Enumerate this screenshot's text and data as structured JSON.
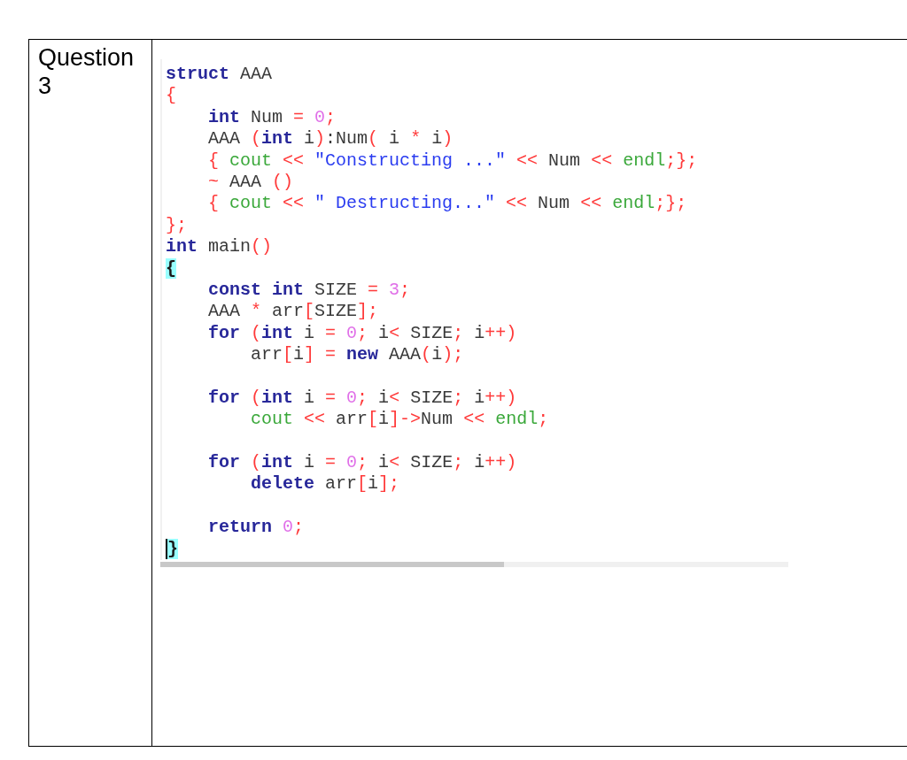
{
  "question": {
    "label": "Question 3"
  },
  "code": {
    "lines": [
      {
        "kind": "code",
        "t": [
          {
            "kind": "kw",
            "text": "struct"
          },
          {
            "kind": "id",
            "text": " AAA"
          }
        ]
      },
      {
        "kind": "code",
        "t": [
          {
            "kind": "op",
            "text": "{"
          }
        ]
      },
      {
        "kind": "code",
        "t": [
          {
            "kind": "kw",
            "text": "    int"
          },
          {
            "kind": "id",
            "text": " Num "
          },
          {
            "kind": "op",
            "text": "="
          },
          {
            "kind": "num",
            "text": " 0"
          },
          {
            "kind": "op",
            "text": ";"
          }
        ]
      },
      {
        "kind": "code",
        "t": [
          {
            "kind": "id",
            "text": "    AAA "
          },
          {
            "kind": "op",
            "text": "("
          },
          {
            "kind": "kw",
            "text": "int"
          },
          {
            "kind": "id",
            "text": " i"
          },
          {
            "kind": "op",
            "text": ")"
          },
          {
            "kind": "id",
            "text": ":Num"
          },
          {
            "kind": "op",
            "text": "("
          },
          {
            "kind": "id",
            "text": " i "
          },
          {
            "kind": "op",
            "text": "*"
          },
          {
            "kind": "id",
            "text": " i"
          },
          {
            "kind": "op",
            "text": ")"
          }
        ]
      },
      {
        "kind": "code",
        "t": [
          {
            "kind": "op",
            "text": "    {"
          },
          {
            "kind": "lib",
            "text": " cout"
          },
          {
            "kind": "op",
            "text": " <<"
          },
          {
            "kind": "str",
            "text": " \"Constructing ...\""
          },
          {
            "kind": "op",
            "text": " <<"
          },
          {
            "kind": "id",
            "text": " Num "
          },
          {
            "kind": "op",
            "text": "<<"
          },
          {
            "kind": "lib",
            "text": " endl"
          },
          {
            "kind": "op",
            "text": ";};"
          }
        ]
      },
      {
        "kind": "code",
        "t": [
          {
            "kind": "op",
            "text": "    ~"
          },
          {
            "kind": "id",
            "text": " AAA "
          },
          {
            "kind": "op",
            "text": "()"
          }
        ]
      },
      {
        "kind": "code",
        "t": [
          {
            "kind": "op",
            "text": "    {"
          },
          {
            "kind": "lib",
            "text": " cout"
          },
          {
            "kind": "op",
            "text": " <<"
          },
          {
            "kind": "str",
            "text": " \" Destructing...\""
          },
          {
            "kind": "op",
            "text": " <<"
          },
          {
            "kind": "id",
            "text": " Num "
          },
          {
            "kind": "op",
            "text": "<<"
          },
          {
            "kind": "lib",
            "text": " endl"
          },
          {
            "kind": "op",
            "text": ";};"
          }
        ]
      },
      {
        "kind": "code",
        "t": [
          {
            "kind": "op",
            "text": "};"
          }
        ]
      },
      {
        "kind": "code",
        "t": [
          {
            "kind": "kw",
            "text": "int"
          },
          {
            "kind": "id",
            "text": " main"
          },
          {
            "kind": "op",
            "text": "()"
          }
        ]
      },
      {
        "kind": "code",
        "t": [
          {
            "kind": "match",
            "text": "{"
          }
        ]
      },
      {
        "kind": "code",
        "t": [
          {
            "kind": "kw",
            "text": "    const int"
          },
          {
            "kind": "id",
            "text": " SIZE "
          },
          {
            "kind": "op",
            "text": "="
          },
          {
            "kind": "num",
            "text": " 3"
          },
          {
            "kind": "op",
            "text": ";"
          }
        ]
      },
      {
        "kind": "code",
        "t": [
          {
            "kind": "id",
            "text": "    AAA "
          },
          {
            "kind": "op",
            "text": "*"
          },
          {
            "kind": "id",
            "text": " arr"
          },
          {
            "kind": "op",
            "text": "["
          },
          {
            "kind": "id",
            "text": "SIZE"
          },
          {
            "kind": "op",
            "text": "];"
          }
        ]
      },
      {
        "kind": "code",
        "t": [
          {
            "kind": "kw",
            "text": "    for"
          },
          {
            "kind": "op",
            "text": " ("
          },
          {
            "kind": "kw",
            "text": "int"
          },
          {
            "kind": "id",
            "text": " i "
          },
          {
            "kind": "op",
            "text": "="
          },
          {
            "kind": "num",
            "text": " 0"
          },
          {
            "kind": "op",
            "text": ";"
          },
          {
            "kind": "id",
            "text": " i"
          },
          {
            "kind": "op",
            "text": "<"
          },
          {
            "kind": "id",
            "text": " SIZE"
          },
          {
            "kind": "op",
            "text": ";"
          },
          {
            "kind": "id",
            "text": " i"
          },
          {
            "kind": "op",
            "text": "++)"
          }
        ]
      },
      {
        "kind": "code",
        "t": [
          {
            "kind": "id",
            "text": "        arr"
          },
          {
            "kind": "op",
            "text": "["
          },
          {
            "kind": "id",
            "text": "i"
          },
          {
            "kind": "op",
            "text": "] ="
          },
          {
            "kind": "kw",
            "text": " new"
          },
          {
            "kind": "id",
            "text": " AAA"
          },
          {
            "kind": "op",
            "text": "("
          },
          {
            "kind": "id",
            "text": "i"
          },
          {
            "kind": "op",
            "text": ");"
          }
        ]
      },
      {
        "kind": "blank"
      },
      {
        "kind": "code",
        "t": [
          {
            "kind": "kw",
            "text": "    for"
          },
          {
            "kind": "op",
            "text": " ("
          },
          {
            "kind": "kw",
            "text": "int"
          },
          {
            "kind": "id",
            "text": " i "
          },
          {
            "kind": "op",
            "text": "="
          },
          {
            "kind": "num",
            "text": " 0"
          },
          {
            "kind": "op",
            "text": ";"
          },
          {
            "kind": "id",
            "text": " i"
          },
          {
            "kind": "op",
            "text": "<"
          },
          {
            "kind": "id",
            "text": " SIZE"
          },
          {
            "kind": "op",
            "text": ";"
          },
          {
            "kind": "id",
            "text": " i"
          },
          {
            "kind": "op",
            "text": "++)"
          }
        ]
      },
      {
        "kind": "code",
        "t": [
          {
            "kind": "lib",
            "text": "        cout"
          },
          {
            "kind": "op",
            "text": " <<"
          },
          {
            "kind": "id",
            "text": " arr"
          },
          {
            "kind": "op",
            "text": "["
          },
          {
            "kind": "id",
            "text": "i"
          },
          {
            "kind": "op",
            "text": "]->"
          },
          {
            "kind": "id",
            "text": "Num "
          },
          {
            "kind": "op",
            "text": "<<"
          },
          {
            "kind": "lib",
            "text": " endl"
          },
          {
            "kind": "op",
            "text": ";"
          }
        ]
      },
      {
        "kind": "blank"
      },
      {
        "kind": "code",
        "t": [
          {
            "kind": "kw",
            "text": "    for"
          },
          {
            "kind": "op",
            "text": " ("
          },
          {
            "kind": "kw",
            "text": "int"
          },
          {
            "kind": "id",
            "text": " i "
          },
          {
            "kind": "op",
            "text": "="
          },
          {
            "kind": "num",
            "text": " 0"
          },
          {
            "kind": "op",
            "text": ";"
          },
          {
            "kind": "id",
            "text": " i"
          },
          {
            "kind": "op",
            "text": "<"
          },
          {
            "kind": "id",
            "text": " SIZE"
          },
          {
            "kind": "op",
            "text": ";"
          },
          {
            "kind": "id",
            "text": " i"
          },
          {
            "kind": "op",
            "text": "++)"
          }
        ]
      },
      {
        "kind": "code",
        "t": [
          {
            "kind": "kw",
            "text": "        delete"
          },
          {
            "kind": "id",
            "text": " arr"
          },
          {
            "kind": "op",
            "text": "["
          },
          {
            "kind": "id",
            "text": "i"
          },
          {
            "kind": "op",
            "text": "];"
          }
        ]
      },
      {
        "kind": "blank"
      },
      {
        "kind": "code",
        "t": [
          {
            "kind": "kw",
            "text": "    return"
          },
          {
            "kind": "num",
            "text": " 0"
          },
          {
            "kind": "op",
            "text": ";"
          }
        ]
      },
      {
        "kind": "code",
        "t": [
          {
            "kind": "cursor",
            "text": "}"
          }
        ]
      }
    ]
  }
}
